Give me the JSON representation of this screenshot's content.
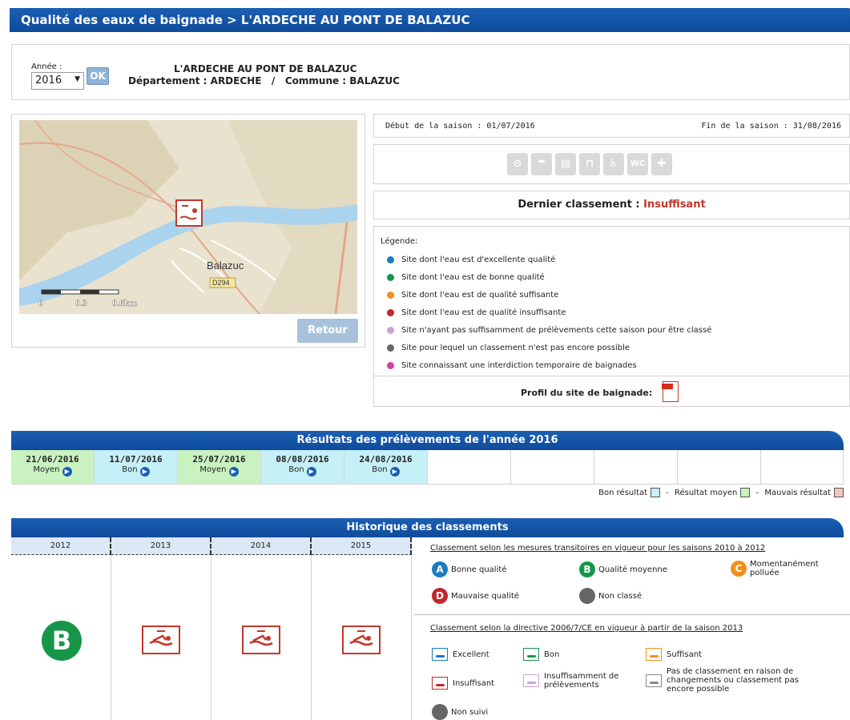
{
  "header": {
    "title": "Qualité des eaux de baignade > L'ARDECHE AU PONT DE BALAZUC"
  },
  "year_select": {
    "label": "Année :",
    "value": "2016",
    "ok_label": "OK"
  },
  "site": {
    "name": "L'ARDECHE AU PONT DE BALAZUC",
    "dept_line": "Département : ARDECHE   /   Commune : BALAZUC"
  },
  "map": {
    "place_label": "Balazuc",
    "road_label": "D294",
    "scale_labels": [
      "0",
      "0.3",
      "0.6km"
    ],
    "retour_label": "Retour"
  },
  "season": {
    "start": "Début de la saison :  01/07/2016",
    "end": "Fin de la saison :  31/08/2016"
  },
  "services_icons": [
    "binoculars-icon",
    "umbrella-icon",
    "shower-icon",
    "shade-icon",
    "wheelchair-icon",
    "wc-icon",
    "first-aid-icon"
  ],
  "last_class": {
    "label": "Dernier classement : ",
    "value": "Insuffisant"
  },
  "legend": {
    "title": "Légende:",
    "items": [
      {
        "text": "Site dont l'eau est d'excellente qualité",
        "color": "#1a7bc4"
      },
      {
        "text": "Site dont l'eau est de bonne qualité",
        "color": "#17964a"
      },
      {
        "text": "Site dont l'eau est de qualité suffisante",
        "color": "#f0901e"
      },
      {
        "text": "Site dont l'eau est de qualité insuffisante",
        "color": "#c0272d"
      },
      {
        "text": "Site n'ayant pas suffisamment de prélèvements cette saison pour être classé",
        "color": "#c9a4d6"
      },
      {
        "text": "Site pour lequel un classement n'est pas encore possible",
        "color": "#666666"
      },
      {
        "text": "Site connaissant une interdiction temporaire de baignades",
        "color": "#d63fa6"
      }
    ],
    "profil_label": "Profil du site de baignade:"
  },
  "results": {
    "title": "Résultats des prélèvements de l'année 2016",
    "samples": [
      {
        "date": "21/06/2016",
        "quality": "Moyen",
        "color": "#c9f2c0"
      },
      {
        "date": "11/07/2016",
        "quality": "Bon",
        "color": "#c6f0f7"
      },
      {
        "date": "25/07/2016",
        "quality": "Moyen",
        "color": "#c9f2c0"
      },
      {
        "date": "08/08/2016",
        "quality": "Bon",
        "color": "#c6f0f7"
      },
      {
        "date": "24/08/2016",
        "quality": "Bon",
        "color": "#c6f0f7"
      }
    ],
    "legend": {
      "good": "Bon résultat",
      "medium": "Résultat moyen",
      "bad": "Mauvais résultat",
      "sep": " - "
    }
  },
  "history": {
    "title": "Historique des classements",
    "years": [
      "2012",
      "2013",
      "2014",
      "2015"
    ],
    "b_letter": "B",
    "transitional": {
      "title": "Classement selon les mesures transitoires en vigueur pour les saisons 2010 à 2012",
      "items": [
        {
          "letter": "A",
          "label": "Bonne qualité",
          "color": "#1a7bc4"
        },
        {
          "letter": "B",
          "label": "Qualité moyenne",
          "color": "#17964a"
        },
        {
          "letter": "C",
          "label": "Momentanément polluée",
          "color": "#f0901e"
        },
        {
          "letter": "D",
          "label": "Mauvaise qualité",
          "color": "#c0272d"
        },
        {
          "letter": "",
          "label": "Non classé",
          "color": "#666666"
        }
      ]
    },
    "directive": {
      "title": "Classement selon la directive 2006/7/CE en vigueur à partir de la saison 2013",
      "items": [
        {
          "label": "Excellent",
          "color": "#1a7bc4"
        },
        {
          "label": "Bon",
          "color": "#17964a"
        },
        {
          "label": "Suffisant",
          "color": "#f0901e"
        },
        {
          "label": "Insuffisant",
          "color": "#c0272d"
        },
        {
          "label": "Insuffisamment de prélèvements",
          "color": "#c9a4d6"
        },
        {
          "label": "Pas de classement en raison de changements ou classement pas encore possible",
          "color": "#888888"
        },
        {
          "label": "Non suivi",
          "color": "#666666"
        }
      ]
    }
  }
}
